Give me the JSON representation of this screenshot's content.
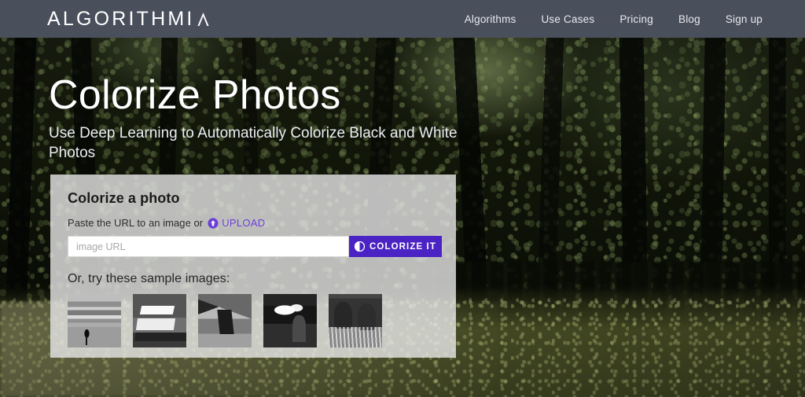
{
  "header": {
    "logo_text": "ALGORITHMI",
    "logo_mark_name": "algorithmia-a-mark",
    "nav": [
      {
        "label": "Algorithms"
      },
      {
        "label": "Use Cases"
      },
      {
        "label": "Pricing"
      },
      {
        "label": "Blog"
      },
      {
        "label": "Sign up"
      }
    ]
  },
  "hero": {
    "title": "Colorize Photos",
    "subtitle": "Use Deep Learning to Automatically Colorize Black and White Photos"
  },
  "card": {
    "title": "Colorize a photo",
    "instruction": "Paste the URL to an image or",
    "upload_label": "UPLOAD",
    "upload_icon": "upload-circle-arrow-icon",
    "input_placeholder": "image URL",
    "input_value": "",
    "button_label": "COLORIZE IT",
    "button_icon": "half-circle-contrast-icon",
    "samples_title": "Or, try these sample images:",
    "samples": [
      {
        "name": "sample-bird-shoreline"
      },
      {
        "name": "sample-sprint-race-car"
      },
      {
        "name": "sample-mountain-rock"
      },
      {
        "name": "sample-person-steam"
      },
      {
        "name": "sample-cows-field"
      }
    ]
  },
  "colors": {
    "header_bar": "#4a4f5c",
    "accent_purple": "#4b23c4",
    "link_purple": "#6b40d8",
    "card_background": "#e8e8e8",
    "hero_text": "#ffffff"
  }
}
